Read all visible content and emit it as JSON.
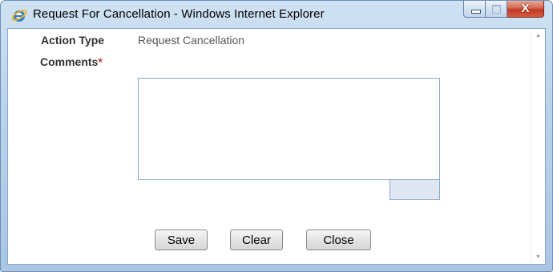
{
  "window": {
    "title": "Request For Cancellation - Windows Internet Explorer",
    "icon": "ie-icon",
    "caption_buttons": {
      "minimize": "minimize-icon",
      "maximize": "maximize-icon",
      "close_glyph": "X"
    }
  },
  "form": {
    "action_type": {
      "label": "Action Type",
      "value": "Request Cancellation"
    },
    "comments": {
      "label": "Comments",
      "required_marker": "*",
      "value": "",
      "counter": ""
    }
  },
  "buttons": {
    "save": "Save",
    "clear": "Clear",
    "close": "Close"
  },
  "colors": {
    "required": "#c0392b",
    "field_border": "#8fa7c3",
    "counter_bg": "#dfe8f2"
  }
}
